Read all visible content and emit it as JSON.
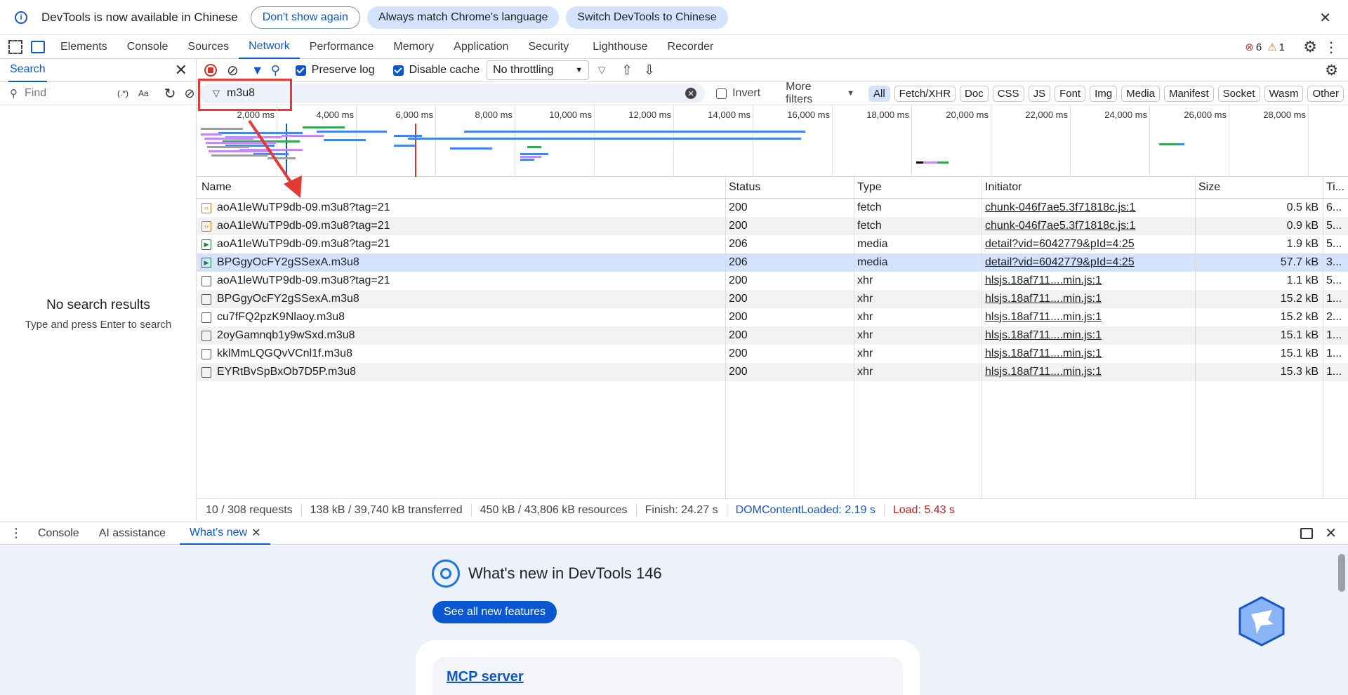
{
  "infobar": {
    "message": "DevTools is now available in Chinese",
    "btn_dont_show": "Don't show again",
    "btn_always_match": "Always match Chrome's language",
    "btn_switch": "Switch DevTools to Chinese"
  },
  "tabs": [
    "Elements",
    "Console",
    "Sources",
    "Network",
    "Performance",
    "Memory",
    "Application",
    "Security",
    "Lighthouse",
    "Recorder"
  ],
  "errors": {
    "error_count": "6",
    "warning_count": "1"
  },
  "sidebar": {
    "title": "Search",
    "find_placeholder": "Find",
    "regex_label": "(.*)",
    "case_label": "Aa",
    "empty_title": "No search results",
    "empty_hint": "Type and press Enter to search"
  },
  "toolbar": {
    "preserve_log": "Preserve log",
    "disable_cache": "Disable cache",
    "throttling": "No throttling"
  },
  "filter": {
    "value": "m3u8",
    "invert": "Invert",
    "more_filters": "More filters",
    "chips": [
      "All",
      "Fetch/XHR",
      "Doc",
      "CSS",
      "JS",
      "Font",
      "Img",
      "Media",
      "Manifest",
      "Socket",
      "Wasm",
      "Other"
    ]
  },
  "overview": {
    "ticks": [
      "2,000 ms",
      "4,000 ms",
      "6,000 ms",
      "8,000 ms",
      "10,000 ms",
      "12,000 ms",
      "14,000 ms",
      "16,000 ms",
      "18,000 ms",
      "20,000 ms",
      "22,000 ms",
      "24,000 ms",
      "26,000 ms",
      "28,000 ms"
    ]
  },
  "table": {
    "headers": {
      "name": "Name",
      "status": "Status",
      "type": "Type",
      "initiator": "Initiator",
      "size": "Size",
      "time": "Ti..."
    },
    "rows": [
      {
        "name": "aoA1leWuTP9db-09.m3u8?tag=21",
        "status": "200",
        "type": "fetch",
        "initiator": "chunk-046f7ae5.3f71818c.js:1",
        "size": "0.5 kB",
        "time": "6..."
      },
      {
        "name": "aoA1leWuTP9db-09.m3u8?tag=21",
        "status": "200",
        "type": "fetch",
        "initiator": "chunk-046f7ae5.3f71818c.js:1",
        "size": "0.9 kB",
        "time": "5..."
      },
      {
        "name": "aoA1leWuTP9db-09.m3u8?tag=21",
        "status": "206",
        "type": "media",
        "initiator": "detail?vid=6042779&pId=4:25",
        "size": "1.9 kB",
        "time": "5..."
      },
      {
        "name": "BPGgyOcFY2gSSexA.m3u8",
        "status": "206",
        "type": "media",
        "initiator": "detail?vid=6042779&pId=4:25",
        "size": "57.7 kB",
        "time": "3..."
      },
      {
        "name": "aoA1leWuTP9db-09.m3u8?tag=21",
        "status": "200",
        "type": "xhr",
        "initiator": "hlsjs.18af711....min.js:1",
        "size": "1.1 kB",
        "time": "5..."
      },
      {
        "name": "BPGgyOcFY2gSSexA.m3u8",
        "status": "200",
        "type": "xhr",
        "initiator": "hlsjs.18af711....min.js:1",
        "size": "15.2 kB",
        "time": "1..."
      },
      {
        "name": "cu7fFQ2pzK9Nlaoy.m3u8",
        "status": "200",
        "type": "xhr",
        "initiator": "hlsjs.18af711....min.js:1",
        "size": "15.2 kB",
        "time": "2..."
      },
      {
        "name": "2oyGamnqb1y9wSxd.m3u8",
        "status": "200",
        "type": "xhr",
        "initiator": "hlsjs.18af711....min.js:1",
        "size": "15.1 kB",
        "time": "1..."
      },
      {
        "name": "kklMmLQGQvVCnl1f.m3u8",
        "status": "200",
        "type": "xhr",
        "initiator": "hlsjs.18af711....min.js:1",
        "size": "15.1 kB",
        "time": "1..."
      },
      {
        "name": "EYRtBvSpBxOb7D5P.m3u8",
        "status": "200",
        "type": "xhr",
        "initiator": "hlsjs.18af711....min.js:1",
        "size": "15.3 kB",
        "time": "1..."
      }
    ]
  },
  "statusbar": {
    "requests": "10 / 308 requests",
    "transferred": "138 kB / 39,740 kB transferred",
    "resources": "450 kB / 43,806 kB resources",
    "finish": "Finish: 24.27 s",
    "dcl": "DOMContentLoaded: 2.19 s",
    "load": "Load: 5.43 s"
  },
  "drawer": {
    "tabs": [
      "Console",
      "AI assistance",
      "What's new"
    ],
    "heading": "What's new in DevTools 146",
    "see_all": "See all new features",
    "card_link": "MCP server"
  },
  "colors": {
    "accent": "#0b57d0",
    "load": "#c5221f",
    "dcl": "#1a56c6",
    "annotation": "#e53935"
  }
}
